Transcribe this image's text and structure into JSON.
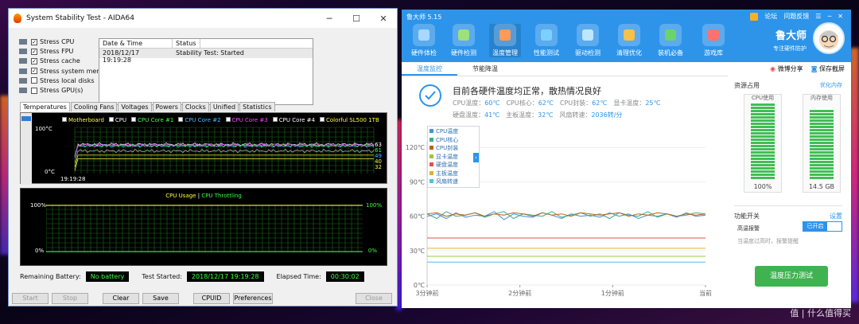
{
  "aida": {
    "title": "System Stability Test - AIDA64",
    "checkboxes": [
      {
        "label": "Stress CPU",
        "checked": true
      },
      {
        "label": "Stress FPU",
        "checked": true
      },
      {
        "label": "Stress cache",
        "checked": true
      },
      {
        "label": "Stress system memory",
        "checked": true
      },
      {
        "label": "Stress local disks",
        "checked": false
      },
      {
        "label": "Stress GPU(s)",
        "checked": false
      }
    ],
    "table": {
      "col_date": "Date & Time",
      "col_status": "Status",
      "rows": [
        {
          "date": "2018/12/17 19:19:28",
          "status": "Stability Test: Started"
        }
      ]
    },
    "tabs": [
      "Temperatures",
      "Cooling Fans",
      "Voltages",
      "Powers",
      "Clocks",
      "Unified",
      "Statistics"
    ],
    "temp_legend": [
      {
        "label": "Motherboard",
        "color": "#ffff40"
      },
      {
        "label": "CPU",
        "color": "#ffffff"
      },
      {
        "label": "CPU Core #1",
        "color": "#40ff40"
      },
      {
        "label": "CPU Core #2",
        "color": "#40c0ff"
      },
      {
        "label": "CPU Core #3",
        "color": "#ff40ff"
      },
      {
        "label": "CPU Core #4",
        "color": "#ffffff"
      },
      {
        "label": "Colorful SL500 1TB",
        "color": "#ffff40"
      }
    ],
    "temp_graph": {
      "y_top": "100°C",
      "y_bottom": "0°C",
      "x_start": "19:19:28",
      "right_values": [
        "63",
        "61",
        "49",
        "40",
        "32"
      ]
    },
    "usage_graph": {
      "title_a": "CPU Usage",
      "sep": "|",
      "title_b": "CPU Throttling",
      "y_top_left": "100%",
      "y_bottom_left": "0%",
      "y_top_right": "100%",
      "y_bottom_right": "0%"
    },
    "info": {
      "battery_label": "Remaining Battery:",
      "battery_value": "No battery",
      "started_label": "Test Started:",
      "started_value": "2018/12/17 19:19:28",
      "elapsed_label": "Elapsed Time:",
      "elapsed_value": "00:30:02"
    },
    "buttons": {
      "start": "Start",
      "stop": "Stop",
      "clear": "Clear",
      "save": "Save",
      "cpuid": "CPUID",
      "preferences": "Preferences",
      "close": "Close"
    }
  },
  "lds": {
    "title": "鲁大师 5.15",
    "top_links": [
      "论坛",
      "问题反馈"
    ],
    "nav": [
      "硬件体检",
      "硬件检测",
      "温度管理",
      "性能测试",
      "驱动检测",
      "清理优化",
      "装机必备",
      "游戏库"
    ],
    "brand_name": "鲁大师",
    "brand_slogan": "专注硬件防护",
    "subtabs": [
      "温度监控",
      "节能降温"
    ],
    "share": "微博分享",
    "screenshot": "保存截屏",
    "summary": "目前各硬件温度均正常，散热情况良好",
    "stats_line1": [
      {
        "label": "CPU温度：",
        "value": "60℃"
      },
      {
        "label": "CPU核心：",
        "value": "62℃"
      },
      {
        "label": "CPU封装：",
        "value": "62℃"
      },
      {
        "label": "显卡温度：",
        "value": "25℃"
      }
    ],
    "stats_line2": [
      {
        "label": "硬盘温度：",
        "value": "41℃"
      },
      {
        "label": "主板温度：",
        "value": "32℃"
      },
      {
        "label": "风扇转速：",
        "value": "2036转/分"
      }
    ],
    "chart_legend": [
      {
        "label": "CPU温度",
        "color": "#4a90d9"
      },
      {
        "label": "CPU核心",
        "color": "#3ab08a"
      },
      {
        "label": "CPU封装",
        "color": "#b5651d"
      },
      {
        "label": "显卡温度",
        "color": "#9bc53d"
      },
      {
        "label": "硬盘温度",
        "color": "#e05050"
      },
      {
        "label": "主板温度",
        "color": "#e0b030"
      },
      {
        "label": "风扇转速",
        "color": "#50c0e0"
      }
    ],
    "right": {
      "resources": "资源占用",
      "optimize": "优化内存",
      "cpu_label": "CPU使用",
      "cpu_value": "100%",
      "cpu_fraction": 1.0,
      "mem_label": "内存使用",
      "mem_value": "14.5 GB",
      "mem_fraction": 0.92,
      "func_title": "功能开关",
      "settings": "设置",
      "alarm": "高温报警",
      "alarm_state": "已开启",
      "alarm_desc": "当温度过高时，报警提醒",
      "stress_btn": "温度压力测试"
    }
  },
  "chart_data": {
    "type": "line",
    "x": [
      "3分钟前",
      "2分钟前",
      "1分钟前",
      "当前"
    ],
    "ylabel": "",
    "yticks": [
      "0℃",
      "30℃",
      "60℃",
      "90℃",
      "120℃"
    ],
    "ylim": [
      0,
      125
    ],
    "series": [
      {
        "name": "CPU温度",
        "values": [
          60,
          62,
          58,
          63,
          59,
          61,
          60,
          64,
          57,
          62,
          60,
          59,
          63,
          61,
          58,
          62,
          60,
          61,
          59,
          63,
          60,
          62,
          58,
          61,
          60,
          62,
          59,
          63,
          60,
          61
        ]
      },
      {
        "name": "CPU核心",
        "values": [
          62,
          58,
          64,
          60,
          61,
          63,
          59,
          62,
          64,
          58,
          62,
          61,
          60,
          64,
          59,
          61,
          63,
          60,
          62,
          58,
          63,
          61,
          60,
          64,
          59,
          62,
          60,
          61,
          63,
          62
        ]
      },
      {
        "name": "CPU封装",
        "values": [
          62,
          63,
          60,
          62,
          61,
          63,
          60,
          62,
          61,
          63,
          62,
          60,
          63,
          61,
          62,
          60,
          63,
          62,
          61,
          62,
          63,
          60,
          62,
          61,
          63,
          62,
          60,
          62,
          61,
          62
        ]
      },
      {
        "name": "显卡温度",
        "values": [
          25,
          25,
          25,
          25,
          25,
          25,
          25,
          25,
          25,
          25,
          25,
          25,
          25,
          25,
          25,
          25,
          25,
          25,
          25,
          25,
          25,
          25,
          25,
          25,
          25,
          25,
          25,
          25,
          25,
          25
        ]
      },
      {
        "name": "硬盘温度",
        "values": [
          41,
          41,
          41,
          41,
          41,
          41,
          41,
          41,
          41,
          41,
          41,
          41,
          41,
          41,
          41,
          41,
          41,
          41,
          41,
          41,
          41,
          41,
          41,
          41,
          41,
          41,
          41,
          41,
          41,
          41
        ]
      },
      {
        "name": "主板温度",
        "values": [
          32,
          32,
          32,
          32,
          32,
          32,
          32,
          32,
          32,
          32,
          32,
          32,
          32,
          32,
          32,
          32,
          32,
          32,
          32,
          32,
          32,
          32,
          32,
          32,
          32,
          32,
          32,
          32,
          32,
          32
        ]
      },
      {
        "name": "风扇转速",
        "values": [
          20,
          20,
          20,
          20,
          20,
          20,
          20,
          20,
          20,
          20,
          20,
          20,
          20,
          20,
          20,
          20,
          20,
          20,
          20,
          20,
          20,
          20,
          20,
          20,
          20,
          20,
          20,
          20,
          20,
          20
        ]
      }
    ]
  },
  "watermark": "值 | 什么值得买",
  "colors": {
    "ld_blue": "#2d94ea",
    "ld_green": "#3eb34f",
    "aida_grid": "#1a6a1a"
  }
}
